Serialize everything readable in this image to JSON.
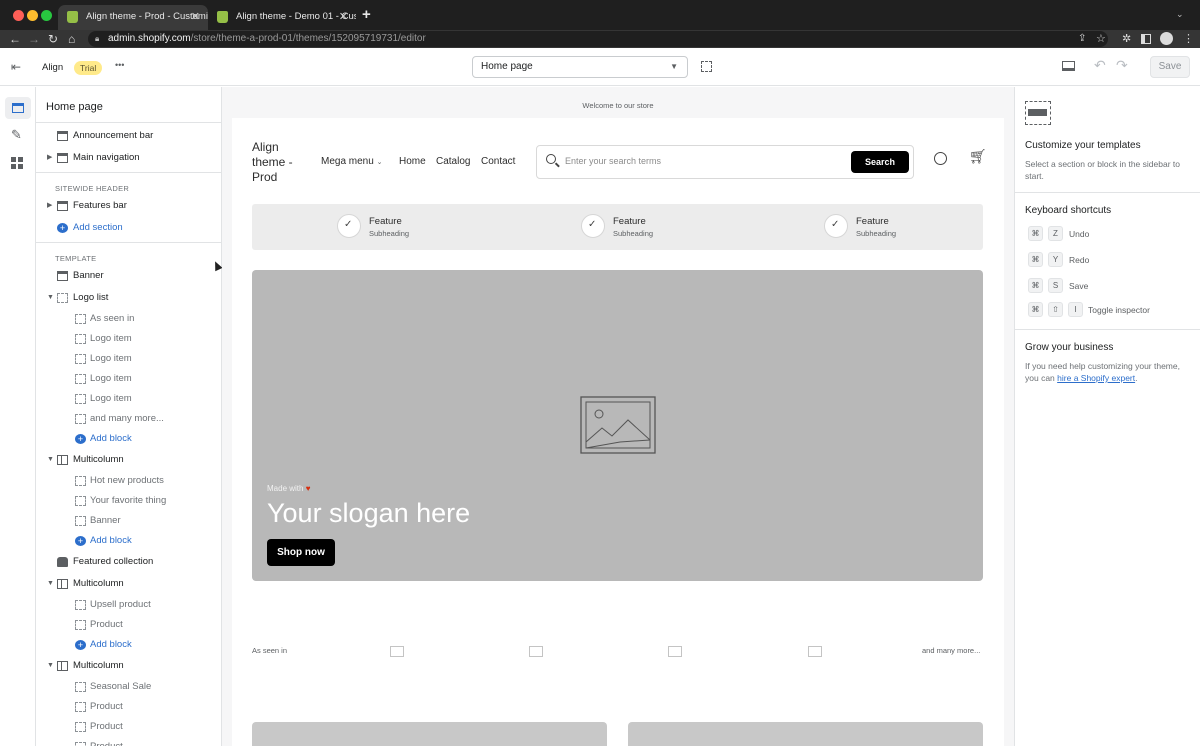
{
  "browser": {
    "tabs": [
      {
        "title": "Align theme - Prod - Customiz",
        "active": true
      },
      {
        "title": "Align theme - Demo 01 - Cust",
        "active": false
      }
    ],
    "new_tab_label": "+",
    "url_host": "admin.shopify.com",
    "url_path": "/store/theme-a-prod-01/themes/152095719731/editor"
  },
  "header": {
    "theme_name": "Align",
    "trial_badge": "Trial",
    "more_label": "•••",
    "page_select": "Home page",
    "save_label": "Save"
  },
  "sidebar": {
    "title": "Home page",
    "header_items": [
      {
        "label": "Announcement bar",
        "caret": ""
      },
      {
        "label": "Main navigation",
        "caret": "▶"
      }
    ],
    "sitewide_label": "SITEWIDE HEADER",
    "sitewide_items": [
      {
        "label": "Features bar",
        "caret": "▶"
      }
    ],
    "add_section_label": "Add section",
    "template_label": "TEMPLATE",
    "banner": "Banner",
    "logo_list": "Logo list",
    "logo_blocks": [
      "As seen in",
      "Logo item",
      "Logo item",
      "Logo item",
      "Logo item",
      "and many more..."
    ],
    "add_block_label": "Add block",
    "multicolumn_label": "Multicolumn",
    "multicolumn1_blocks": [
      "Hot new products",
      "Your favorite thing",
      "Banner"
    ],
    "featured_collection": "Featured collection",
    "multicolumn2_blocks": [
      "Upsell product",
      "Product"
    ],
    "multicolumn3_blocks": [
      "Seasonal Sale",
      "Product",
      "Product",
      "Product"
    ]
  },
  "preview": {
    "welcome": "Welcome to our store",
    "store_name": "Align theme - Prod",
    "nav": [
      "Mega menu",
      "Home",
      "Catalog",
      "Contact"
    ],
    "search_placeholder": "Enter your search terms",
    "search_button": "Search",
    "features": [
      {
        "title": "Feature",
        "subtitle": "Subheading"
      },
      {
        "title": "Feature",
        "subtitle": "Subheading"
      },
      {
        "title": "Feature",
        "subtitle": "Subheading"
      }
    ],
    "made_with": "Made with",
    "slogan": "Your slogan here",
    "shop_now": "Shop now",
    "as_seen_in": "As seen in",
    "many_more": "and many more..."
  },
  "right_panel": {
    "customize_title": "Customize your templates",
    "customize_text": "Select a section or block in the sidebar to start.",
    "shortcuts_title": "Keyboard shortcuts",
    "shortcuts": [
      {
        "keys": [
          "⌘",
          "Z"
        ],
        "label": "Undo"
      },
      {
        "keys": [
          "⌘",
          "Y"
        ],
        "label": "Redo"
      },
      {
        "keys": [
          "⌘",
          "S"
        ],
        "label": "Save"
      },
      {
        "keys": [
          "⌘",
          "⇧",
          "I"
        ],
        "label": "Toggle inspector"
      }
    ],
    "grow_title": "Grow your business",
    "grow_text": "If you need help customizing your theme, you can",
    "grow_link": "hire a Shopify expert",
    "grow_suffix": "."
  },
  "colors": {
    "accent": "#2c6ecb",
    "trial_badge_bg": "#ffea8a",
    "banner_bg": "#b8b8b8"
  }
}
